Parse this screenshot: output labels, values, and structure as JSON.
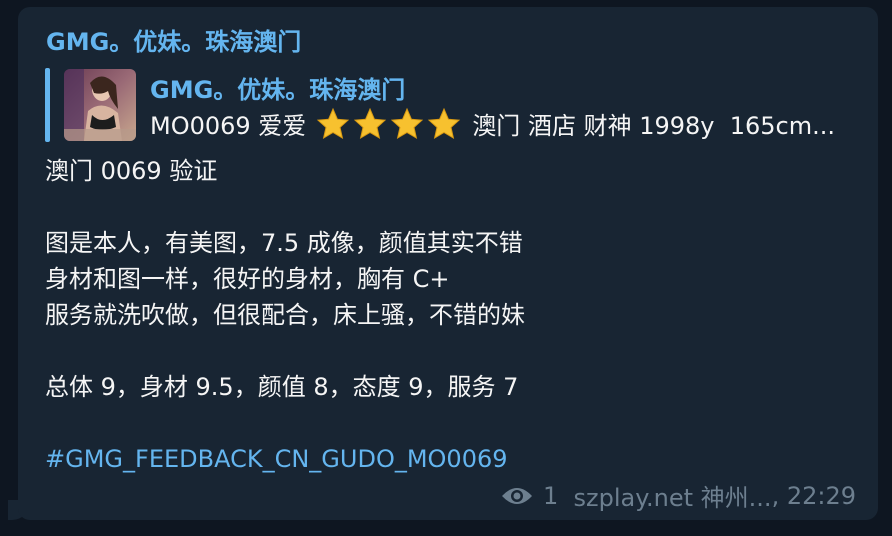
{
  "message": {
    "sender": "GMG。优妹。珠海澳门",
    "reply": {
      "title": "GMG。优妹。珠海澳门",
      "text_before_stars": "MO0069 爱爱",
      "stars_count": 4,
      "text_after_stars": "澳门 酒店 财神 1998y  165cm..."
    },
    "body_lines": [
      "澳门 0069 验证",
      "",
      "图是本人，有美图，7.5 成像，颜值其实不错",
      "身材和图一样，很好的身材，胸有 C+",
      "服务就洗吹做，但很配合，床上骚，不错的妹",
      "",
      "总体 9，身材 9.5，颜值 8，态度 9，服务 7",
      ""
    ],
    "hashtag": "#GMG_FEEDBACK_CN_GUDO_MO0069",
    "views": "1",
    "signature": "szplay.net 神州...",
    "time": "22:29"
  },
  "colors": {
    "background": "#0e1621",
    "bubble": "#182533",
    "accent": "#64b5ef",
    "text": "#f5f5f5",
    "meta": "#6d7f8f",
    "star": "#f7c12f"
  },
  "icons": {
    "views": "eye-icon",
    "rating": "star-icon"
  }
}
